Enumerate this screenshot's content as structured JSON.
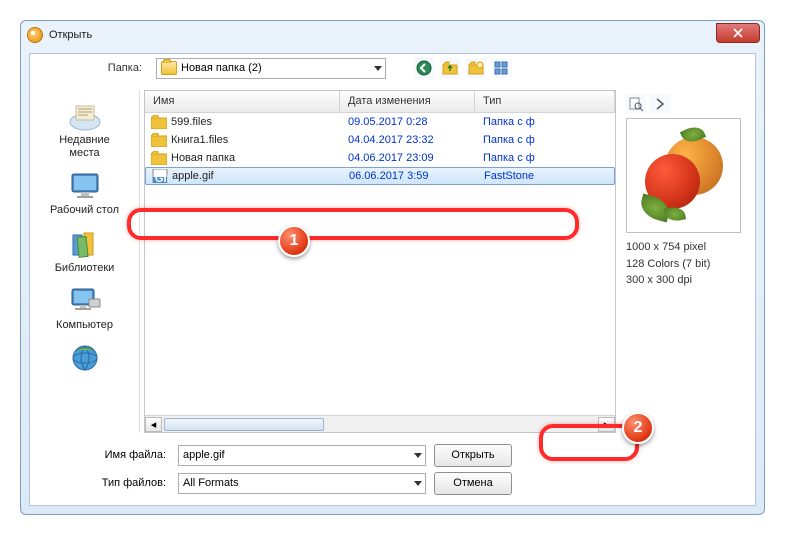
{
  "window": {
    "title": "Открыть"
  },
  "toolbar": {
    "folder_label": "Папка:",
    "folder_value": "Новая папка (2)"
  },
  "places": [
    {
      "label": "Недавние места"
    },
    {
      "label": "Рабочий стол"
    },
    {
      "label": "Библиотеки"
    },
    {
      "label": "Компьютер"
    },
    {
      "label": ""
    }
  ],
  "columns": {
    "name": "Имя",
    "date": "Дата изменения",
    "type": "Тип"
  },
  "files": [
    {
      "name": "599.files",
      "date": "09.05.2017 0:28",
      "type": "Папка с ф",
      "kind": "folder"
    },
    {
      "name": "Книга1.files",
      "date": "04.04.2017 23:32",
      "type": "Папка с ф",
      "kind": "folder"
    },
    {
      "name": "Новая папка",
      "date": "04.06.2017 23:09",
      "type": "Папка с ф",
      "kind": "folder"
    },
    {
      "name": "apple.gif",
      "date": "06.06.2017 3:59",
      "type": "FastStone",
      "kind": "gif",
      "selected": true
    }
  ],
  "preview": {
    "dimensions": "1000 x 754 pixel",
    "colors": "128 Colors (7 bit)",
    "dpi": "300 x 300 dpi"
  },
  "bottom": {
    "filename_label": "Имя файла:",
    "filename_value": "apple.gif",
    "filetype_label": "Тип файлов:",
    "filetype_value": "All Formats",
    "open": "Открыть",
    "cancel": "Отмена"
  },
  "annotations": {
    "badge1": "1",
    "badge2": "2"
  }
}
